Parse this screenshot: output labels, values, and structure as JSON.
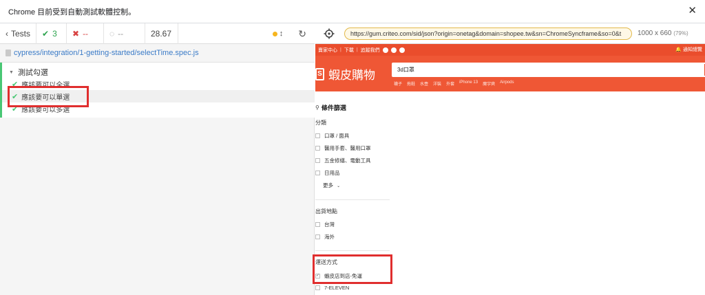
{
  "infobar": {
    "message": "Chrome 目前受到自動測試軟體控制。",
    "close_glyph": "✕"
  },
  "runner": {
    "tests_label": "Tests",
    "passed": "3",
    "failed": "--",
    "pending": "--",
    "duration": "28.67",
    "spec_path": "cypress/integration/1-getting-started/selectTime.spec.js",
    "suite_title": "測試勾選",
    "tests": [
      "應該要可以全選",
      "應該要可以單選",
      "應該要可以多選"
    ]
  },
  "aut": {
    "url": "https://gum.criteo.com/sid/json?origin=onetag&domain=shopee.tw&sn=ChromeSyncframe&so=0&t",
    "viewport_size": "1000 x 660",
    "viewport_scale": "(79%)"
  },
  "shopee": {
    "topbar": [
      "賣家中心",
      "下載",
      "追蹤我們"
    ],
    "notify": "通知總覽",
    "logo_text": "蝦皮購物",
    "search_value": "3d口罩",
    "search_hints": [
      "襪子",
      "拖鞋",
      "水壺",
      "洋裝",
      "外套",
      "iPhone 13",
      "魔宇爽",
      "Airpods"
    ],
    "filter_title": "條件篩選",
    "category": {
      "title": "分類",
      "options": [
        "口罩 / 面具",
        "醫用手套、醫用口罩",
        "五金修繕、電動工具",
        "日用品"
      ],
      "more": "更多"
    },
    "location": {
      "title": "出貨地點",
      "options": [
        "台灣",
        "海外"
      ]
    },
    "shipping": {
      "title": "運送方式",
      "options": [
        "蝦皮店到店-免運",
        "7-ELEVEN"
      ]
    }
  },
  "colors": {
    "shopee_orange": "#ee4d2d",
    "pass_green": "#48c774",
    "highlight_red": "#e02e2e"
  }
}
